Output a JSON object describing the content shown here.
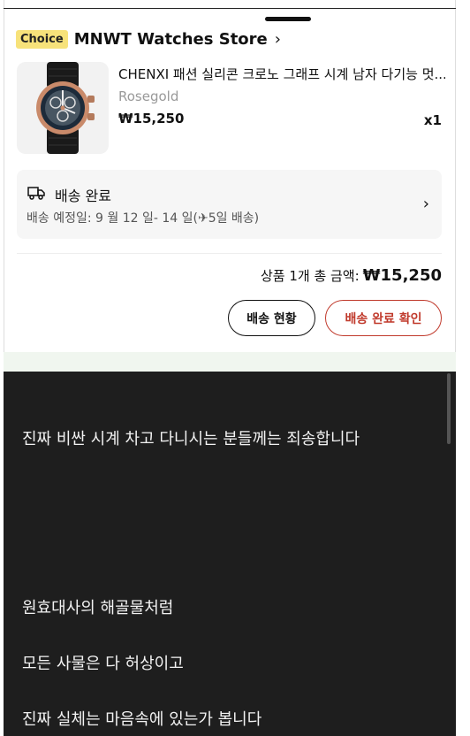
{
  "store": {
    "badge": "Choice",
    "name": "MNWT Watches Store",
    "chevron": "›"
  },
  "product": {
    "title": "CHENXI 패션 실리콘 크로노 그래프 시계 남자 다기능 멋...",
    "variant": "Rosegold",
    "price": "₩15,250",
    "quantity": "x1"
  },
  "shipping": {
    "icon": "truck-icon",
    "status": "배송 완료",
    "eta": "배송 예정일: 9 월 12 일- 14 일(✈5일 배송)",
    "chevron": "›"
  },
  "summary": {
    "label": "상품 1개 총 금액:",
    "amount": "₩15,250"
  },
  "actions": {
    "track": "배송 현황",
    "confirm": "배송 완료 확인"
  },
  "colors": {
    "choice_badge": "#f7e27a",
    "confirm_accent": "#c0392b",
    "dark_panel": "#1e1e1e"
  },
  "caption": {
    "lines": [
      "진짜 비싼 시계 차고 다니시는 분들께는 죄송합니다",
      "원효대사의 해골물처럼",
      "모든 사물은 다 허상이고",
      "진짜 실체는 마음속에 있는가 봅니다"
    ]
  }
}
